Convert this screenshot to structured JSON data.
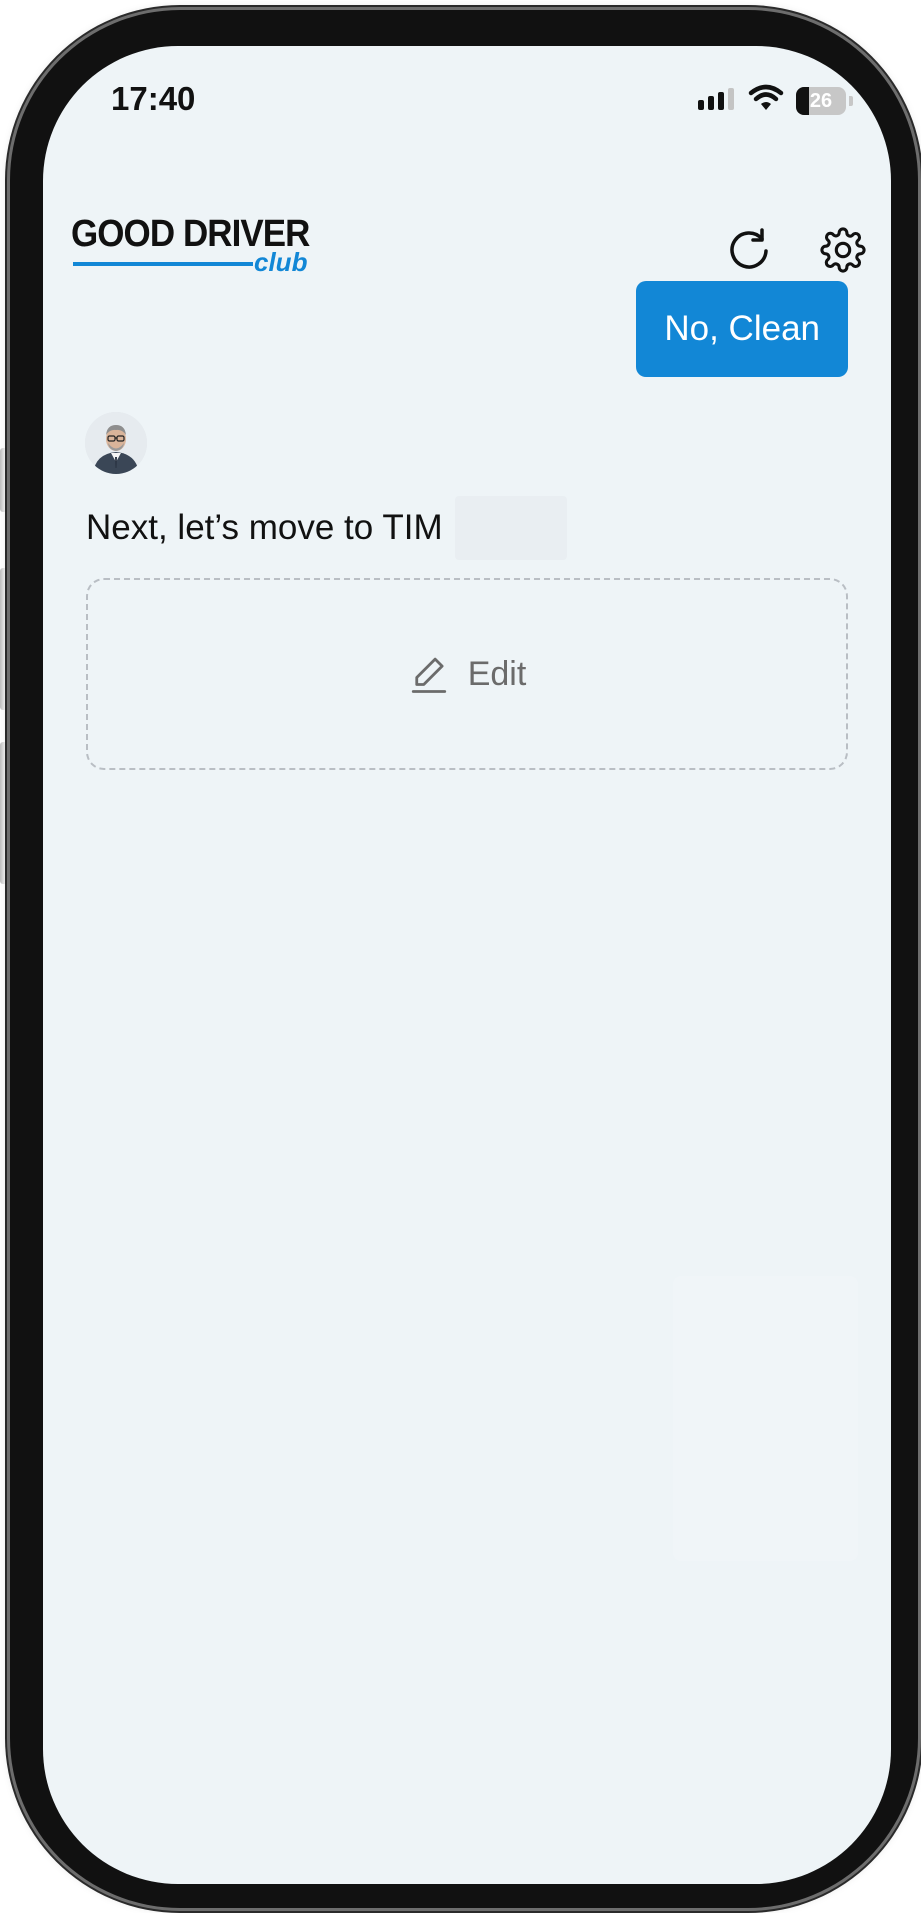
{
  "status_bar": {
    "time": "17:40",
    "battery": "26",
    "battery_level": 0.26,
    "icons": [
      "signal-icon",
      "wifi-icon",
      "battery-icon"
    ]
  },
  "header": {
    "logo_main": "GOOD DRIVER",
    "logo_sub": "club",
    "refresh_icon": "refresh-icon",
    "settings_icon": "gear-icon"
  },
  "conversation": {
    "user_reply": "No, Clean",
    "bot_message": "Next, let’s move to TIM",
    "edit_label": "Edit",
    "edit_icon": "pencil-icon"
  },
  "colors": {
    "accent": "#1287d6",
    "screen_bg": "#eef4f7",
    "text": "#111111",
    "muted": "#6b6b6b"
  }
}
